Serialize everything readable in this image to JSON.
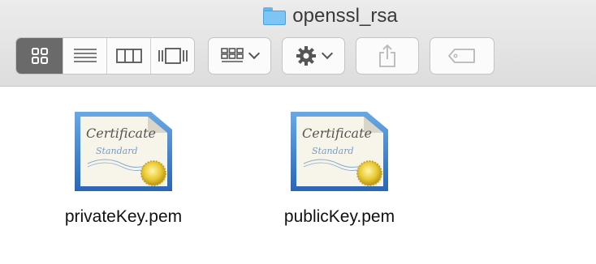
{
  "window": {
    "title": "openssl_rsa",
    "title_icon": "folder-icon"
  },
  "toolbar": {
    "view_modes": [
      {
        "name": "icon-view",
        "icon": "grid-icon",
        "active": true
      },
      {
        "name": "list-view",
        "icon": "list-icon",
        "active": false
      },
      {
        "name": "column-view",
        "icon": "columns-icon",
        "active": false
      },
      {
        "name": "cover-flow-view",
        "icon": "coverflow-icon",
        "active": false
      }
    ],
    "arrange_icon": "arrange-grid-icon",
    "action_icon": "gear-icon",
    "share_icon": "share-icon",
    "tag_icon": "tag-icon"
  },
  "files": [
    {
      "name": "privateKey.pem",
      "icon": "certificate-icon"
    },
    {
      "name": "publicKey.pem",
      "icon": "certificate-icon"
    }
  ],
  "colors": {
    "active_segment": "#6a6a6a",
    "folder": "#7cc5f5",
    "certificate_border": "#3d7fc9",
    "seal": "#e8c930"
  }
}
